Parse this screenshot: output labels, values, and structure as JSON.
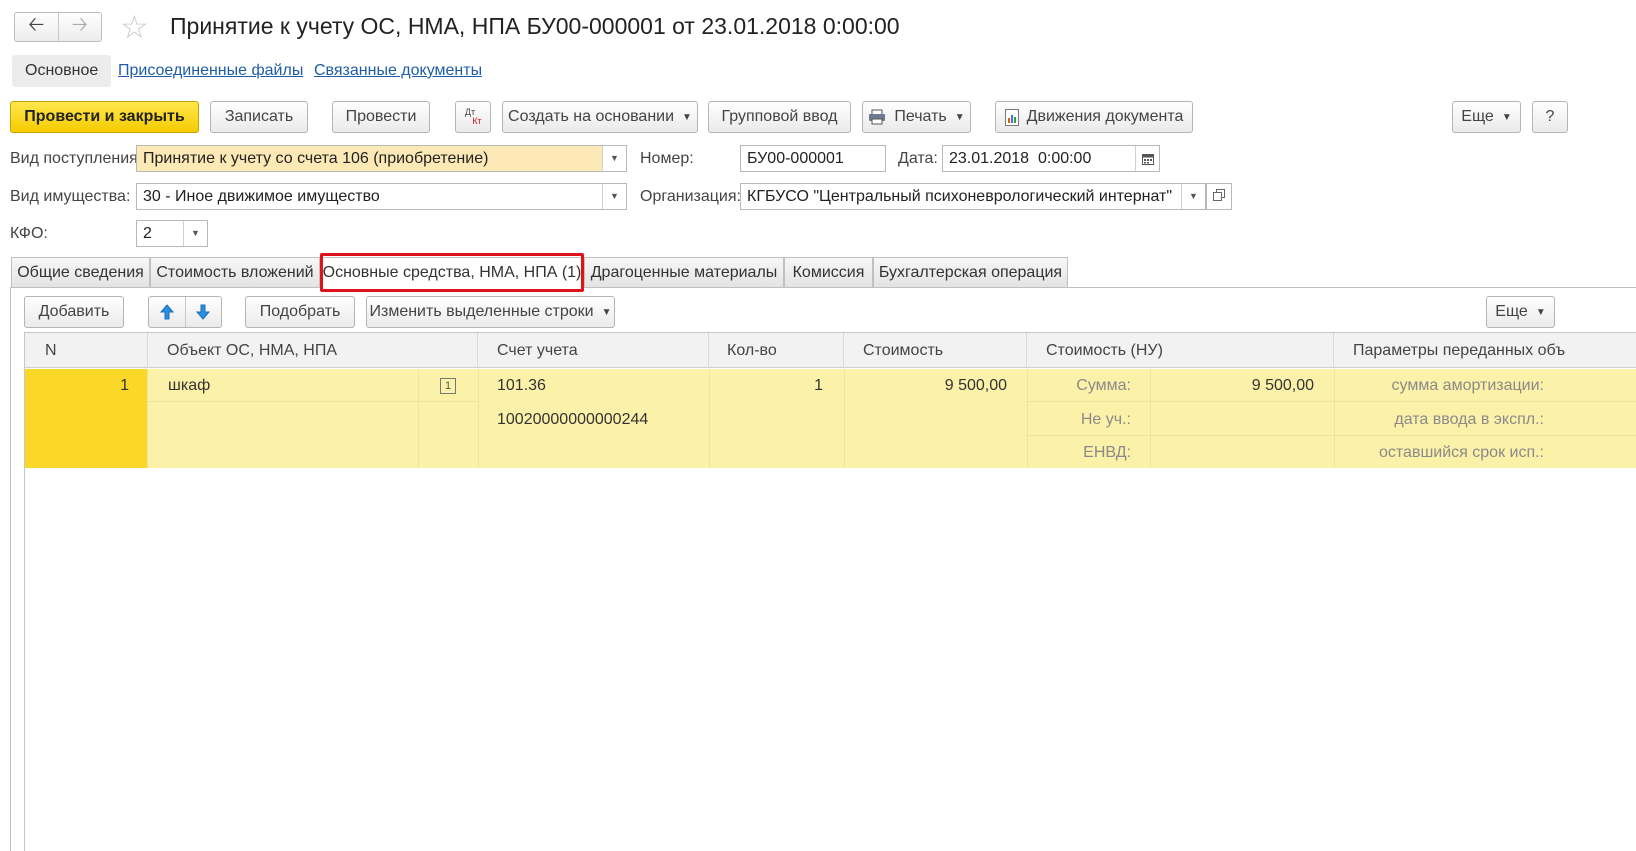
{
  "window": {
    "title": "Принятие к учету ОС, НМА, НПА БУ00-000001 от 23.01.2018 0:00:00",
    "back_icon": "arrow-left-icon",
    "forward_icon": "arrow-right-icon",
    "favorite_icon": "star-icon"
  },
  "sections": {
    "main": "Основное",
    "attached": "Присоединенные файлы",
    "related": "Связанные документы"
  },
  "toolbar": {
    "post_close": "Провести и закрыть",
    "save": "Записать",
    "post": "Провести",
    "dt_top": "Дт",
    "dt_bottom": "Кт",
    "create_based": "Создать на основании",
    "group_input": "Групповой ввод",
    "print": "Печать",
    "movements": "Движения документа",
    "more": "Еще",
    "help": "?"
  },
  "form": {
    "receipt_type_label": "Вид поступления:",
    "receipt_type_value": "Принятие к учету со счета 106 (приобретение)",
    "number_label": "Номер:",
    "number_value": "БУ00-000001",
    "date_label": "Дата:",
    "date_value": "23.01.2018  0:00:00",
    "property_type_label": "Вид имущества:",
    "property_type_value": "30 - Иное движимое имущество",
    "org_label": "Организация:",
    "org_value": "КГБУСО \"Центральный психоневрологический интернат\"",
    "kfo_label": "КФО:",
    "kfo_value": "2"
  },
  "tabs": [
    "Общие сведения",
    "Стоимость вложений",
    "Основные средства, НМА, НПА (1)",
    "Драгоценные материалы",
    "Комиссия",
    "Бухгалтерская операция"
  ],
  "active_tab_index": 2,
  "table_toolbar": {
    "add": "Добавить",
    "up_icon": "arrow-up-icon",
    "down_icon": "arrow-down-icon",
    "pick": "Подобрать",
    "change_rows": "Изменить выделенные строки",
    "more": "Еще"
  },
  "table": {
    "columns": [
      "N",
      "Объект ОС, НМА, НПА",
      "Счет учета",
      "Кол-во",
      "Стоимость",
      "Стоимость (НУ)",
      "Параметры переданных объ"
    ],
    "rows": [
      {
        "n": "1",
        "object": "шкаф",
        "account": "101.36",
        "inventory": "10020000000000244",
        "qty": "1",
        "cost": "9 500,00",
        "nu_labels": [
          "Сумма:",
          "Не уч.:",
          "ЕНВД:"
        ],
        "nu_sum": "9 500,00",
        "params": [
          "сумма амортизации:",
          "дата ввода в экспл.:",
          "оставшийся срок исп.:"
        ]
      }
    ]
  }
}
